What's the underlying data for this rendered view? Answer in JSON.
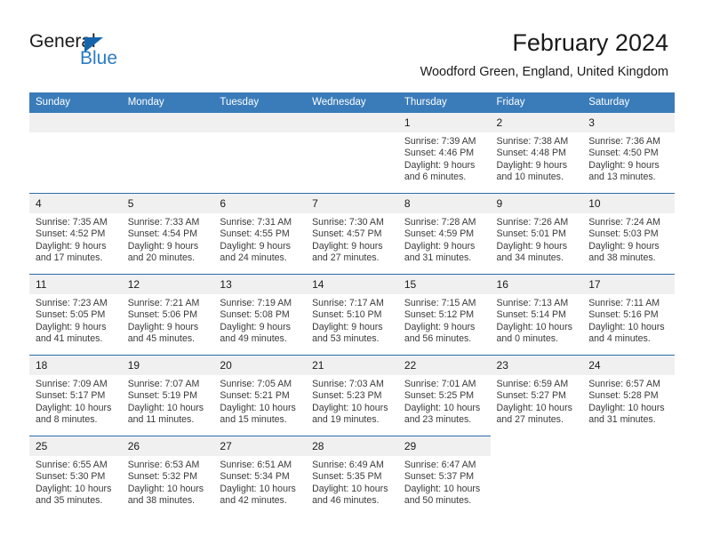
{
  "logo": {
    "line1": "General",
    "line2": "Blue",
    "triangle_color": "#1565ad",
    "blue_text_color": "#2b7cc4"
  },
  "header": {
    "title": "February 2024",
    "location": "Woodford Green, England, United Kingdom"
  },
  "theme": {
    "header_row_bg": "#3a7cba",
    "row_separator": "#2b6ca8",
    "daynum_bg": "#f0f0f0"
  },
  "weekday_headers": [
    "Sunday",
    "Monday",
    "Tuesday",
    "Wednesday",
    "Thursday",
    "Friday",
    "Saturday"
  ],
  "weeks": [
    [
      {
        "day": "",
        "lines": []
      },
      {
        "day": "",
        "lines": []
      },
      {
        "day": "",
        "lines": []
      },
      {
        "day": "",
        "lines": []
      },
      {
        "day": "1",
        "lines": [
          "Sunrise: 7:39 AM",
          "Sunset: 4:46 PM",
          "Daylight: 9 hours",
          "and 6 minutes."
        ]
      },
      {
        "day": "2",
        "lines": [
          "Sunrise: 7:38 AM",
          "Sunset: 4:48 PM",
          "Daylight: 9 hours",
          "and 10 minutes."
        ]
      },
      {
        "day": "3",
        "lines": [
          "Sunrise: 7:36 AM",
          "Sunset: 4:50 PM",
          "Daylight: 9 hours",
          "and 13 minutes."
        ]
      }
    ],
    [
      {
        "day": "4",
        "lines": [
          "Sunrise: 7:35 AM",
          "Sunset: 4:52 PM",
          "Daylight: 9 hours",
          "and 17 minutes."
        ]
      },
      {
        "day": "5",
        "lines": [
          "Sunrise: 7:33 AM",
          "Sunset: 4:54 PM",
          "Daylight: 9 hours",
          "and 20 minutes."
        ]
      },
      {
        "day": "6",
        "lines": [
          "Sunrise: 7:31 AM",
          "Sunset: 4:55 PM",
          "Daylight: 9 hours",
          "and 24 minutes."
        ]
      },
      {
        "day": "7",
        "lines": [
          "Sunrise: 7:30 AM",
          "Sunset: 4:57 PM",
          "Daylight: 9 hours",
          "and 27 minutes."
        ]
      },
      {
        "day": "8",
        "lines": [
          "Sunrise: 7:28 AM",
          "Sunset: 4:59 PM",
          "Daylight: 9 hours",
          "and 31 minutes."
        ]
      },
      {
        "day": "9",
        "lines": [
          "Sunrise: 7:26 AM",
          "Sunset: 5:01 PM",
          "Daylight: 9 hours",
          "and 34 minutes."
        ]
      },
      {
        "day": "10",
        "lines": [
          "Sunrise: 7:24 AM",
          "Sunset: 5:03 PM",
          "Daylight: 9 hours",
          "and 38 minutes."
        ]
      }
    ],
    [
      {
        "day": "11",
        "lines": [
          "Sunrise: 7:23 AM",
          "Sunset: 5:05 PM",
          "Daylight: 9 hours",
          "and 41 minutes."
        ]
      },
      {
        "day": "12",
        "lines": [
          "Sunrise: 7:21 AM",
          "Sunset: 5:06 PM",
          "Daylight: 9 hours",
          "and 45 minutes."
        ]
      },
      {
        "day": "13",
        "lines": [
          "Sunrise: 7:19 AM",
          "Sunset: 5:08 PM",
          "Daylight: 9 hours",
          "and 49 minutes."
        ]
      },
      {
        "day": "14",
        "lines": [
          "Sunrise: 7:17 AM",
          "Sunset: 5:10 PM",
          "Daylight: 9 hours",
          "and 53 minutes."
        ]
      },
      {
        "day": "15",
        "lines": [
          "Sunrise: 7:15 AM",
          "Sunset: 5:12 PM",
          "Daylight: 9 hours",
          "and 56 minutes."
        ]
      },
      {
        "day": "16",
        "lines": [
          "Sunrise: 7:13 AM",
          "Sunset: 5:14 PM",
          "Daylight: 10 hours",
          "and 0 minutes."
        ]
      },
      {
        "day": "17",
        "lines": [
          "Sunrise: 7:11 AM",
          "Sunset: 5:16 PM",
          "Daylight: 10 hours",
          "and 4 minutes."
        ]
      }
    ],
    [
      {
        "day": "18",
        "lines": [
          "Sunrise: 7:09 AM",
          "Sunset: 5:17 PM",
          "Daylight: 10 hours",
          "and 8 minutes."
        ]
      },
      {
        "day": "19",
        "lines": [
          "Sunrise: 7:07 AM",
          "Sunset: 5:19 PM",
          "Daylight: 10 hours",
          "and 11 minutes."
        ]
      },
      {
        "day": "20",
        "lines": [
          "Sunrise: 7:05 AM",
          "Sunset: 5:21 PM",
          "Daylight: 10 hours",
          "and 15 minutes."
        ]
      },
      {
        "day": "21",
        "lines": [
          "Sunrise: 7:03 AM",
          "Sunset: 5:23 PM",
          "Daylight: 10 hours",
          "and 19 minutes."
        ]
      },
      {
        "day": "22",
        "lines": [
          "Sunrise: 7:01 AM",
          "Sunset: 5:25 PM",
          "Daylight: 10 hours",
          "and 23 minutes."
        ]
      },
      {
        "day": "23",
        "lines": [
          "Sunrise: 6:59 AM",
          "Sunset: 5:27 PM",
          "Daylight: 10 hours",
          "and 27 minutes."
        ]
      },
      {
        "day": "24",
        "lines": [
          "Sunrise: 6:57 AM",
          "Sunset: 5:28 PM",
          "Daylight: 10 hours",
          "and 31 minutes."
        ]
      }
    ],
    [
      {
        "day": "25",
        "lines": [
          "Sunrise: 6:55 AM",
          "Sunset: 5:30 PM",
          "Daylight: 10 hours",
          "and 35 minutes."
        ]
      },
      {
        "day": "26",
        "lines": [
          "Sunrise: 6:53 AM",
          "Sunset: 5:32 PM",
          "Daylight: 10 hours",
          "and 38 minutes."
        ]
      },
      {
        "day": "27",
        "lines": [
          "Sunrise: 6:51 AM",
          "Sunset: 5:34 PM",
          "Daylight: 10 hours",
          "and 42 minutes."
        ]
      },
      {
        "day": "28",
        "lines": [
          "Sunrise: 6:49 AM",
          "Sunset: 5:35 PM",
          "Daylight: 10 hours",
          "and 46 minutes."
        ]
      },
      {
        "day": "29",
        "lines": [
          "Sunrise: 6:47 AM",
          "Sunset: 5:37 PM",
          "Daylight: 10 hours",
          "and 50 minutes."
        ]
      },
      {
        "day": "",
        "lines": []
      },
      {
        "day": "",
        "lines": []
      }
    ]
  ]
}
